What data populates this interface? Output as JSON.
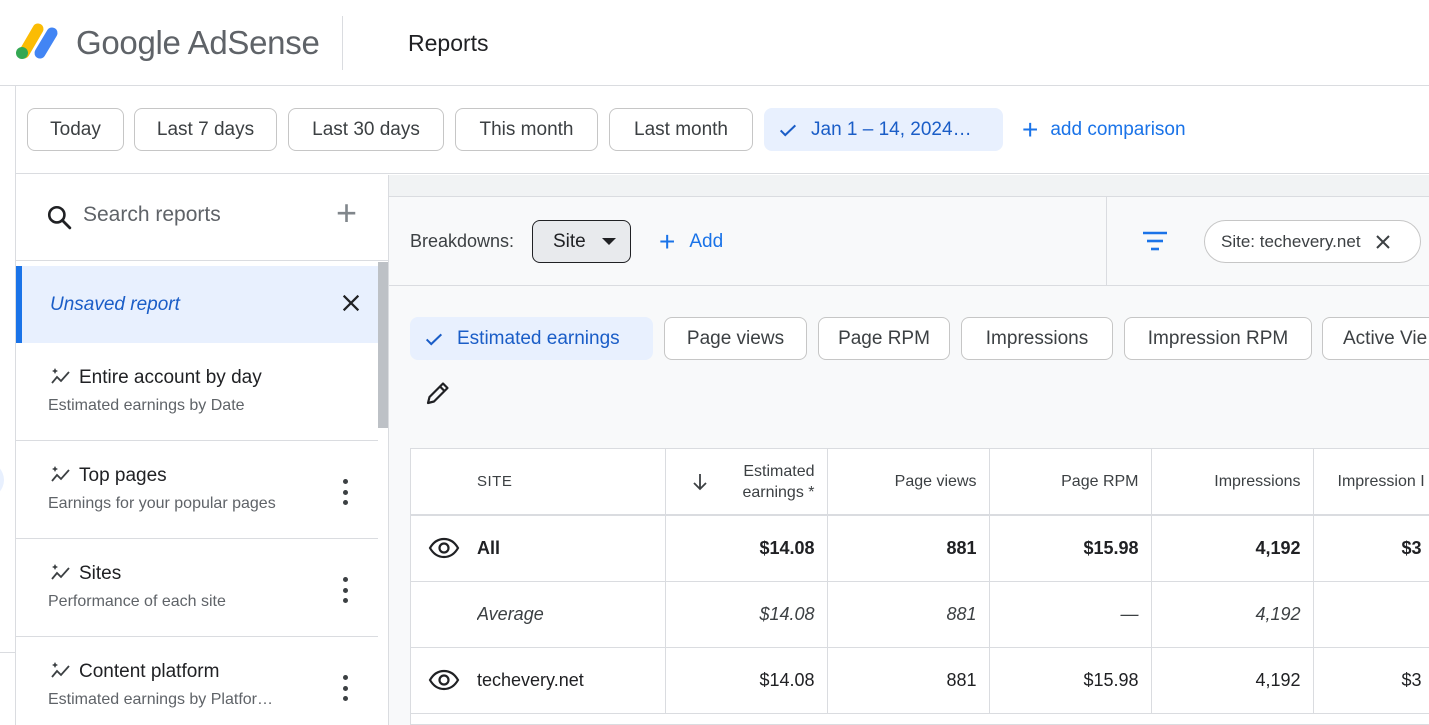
{
  "header": {
    "product_name": "Google AdSense",
    "page_title": "Reports"
  },
  "date_ranges": {
    "options": [
      "Today",
      "Last 7 days",
      "Last 30 days",
      "This month",
      "Last month"
    ],
    "selected": "Jan 1 – 14, 2024…",
    "add_comparison": "add comparison"
  },
  "sidebar": {
    "search_placeholder": "Search reports",
    "unsaved_label": "Unsaved report",
    "reports": [
      {
        "title": "Entire account by day",
        "subtitle": "Estimated earnings by Date"
      },
      {
        "title": "Top pages",
        "subtitle": "Earnings for your popular pages"
      },
      {
        "title": "Sites",
        "subtitle": "Performance of each site"
      },
      {
        "title": "Content platform",
        "subtitle": "Estimated earnings by Platfor…"
      }
    ]
  },
  "breakdowns": {
    "label": "Breakdowns:",
    "selected": "Site",
    "add_label": "Add"
  },
  "filter": {
    "chip_label": "Site: techevery.net"
  },
  "metrics": {
    "selected": "Estimated earnings",
    "options": [
      "Page views",
      "Page RPM",
      "Impressions",
      "Impression RPM",
      "Active Vie"
    ]
  },
  "table": {
    "headers": [
      "SITE",
      "Estimated earnings *",
      "Page views",
      "Page RPM",
      "Impressions",
      "Impression I"
    ],
    "header_estimated_line1": "Estimated",
    "header_estimated_line2": "earnings *",
    "rows": [
      {
        "kind": "total",
        "site": "All",
        "earnings": "$14.08",
        "page_views": "881",
        "page_rpm": "$15.98",
        "impressions": "4,192",
        "impression_rpm": "$3"
      },
      {
        "kind": "avg",
        "site": "Average",
        "earnings": "$14.08",
        "page_views": "881",
        "page_rpm": "—",
        "impressions": "4,192",
        "impression_rpm": ""
      },
      {
        "kind": "site",
        "site": "techevery.net",
        "earnings": "$14.08",
        "page_views": "881",
        "page_rpm": "$15.98",
        "impressions": "4,192",
        "impression_rpm": "$3"
      }
    ]
  },
  "colors": {
    "accent": "#1a73e8",
    "selected_bg": "#e8f0fe",
    "logo_yellow": "#fbbc04",
    "logo_blue": "#4285f4"
  }
}
